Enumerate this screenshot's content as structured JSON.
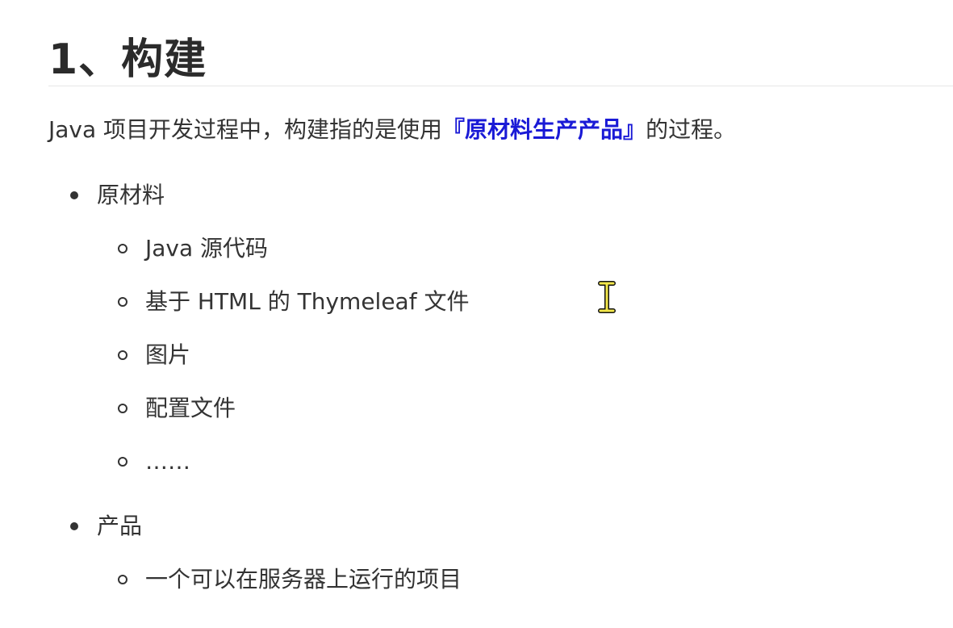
{
  "heading": "1、构建",
  "paragraph": {
    "before": "Java 项目开发过程中，构建指的是使用",
    "highlight": "『原材料生产产品』",
    "after": "的过程。"
  },
  "list": [
    {
      "label": "原材料",
      "children": [
        "Java 源代码",
        "基于 HTML 的 Thymeleaf 文件",
        "图片",
        "配置文件",
        "……"
      ]
    },
    {
      "label": "产品",
      "children": [
        "一个可以在服务器上运行的项目"
      ]
    }
  ],
  "cursor": "text-cursor-icon",
  "colors": {
    "text": "#333333",
    "heading": "#2b2b2b",
    "highlight": "#1a1ad6",
    "rule": "#e6e6e6"
  }
}
